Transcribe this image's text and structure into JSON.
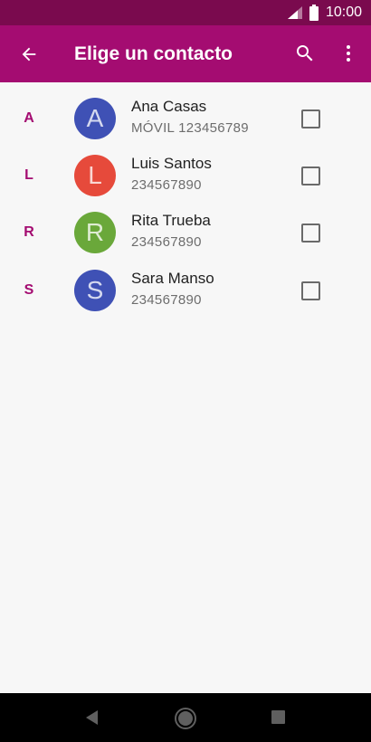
{
  "status_bar": {
    "time": "10:00"
  },
  "app_bar": {
    "title": "Elige un contacto",
    "back_icon": "arrow-back-icon",
    "search_icon": "search-icon",
    "overflow_icon": "more-vert-icon"
  },
  "contacts": [
    {
      "letter": "A",
      "initial": "A",
      "name": "Ana Casas",
      "number": "MÓVIL 123456789",
      "avatar_color": "#3f51b5",
      "checked": false
    },
    {
      "letter": "L",
      "initial": "L",
      "name": "Luis Santos",
      "number": "234567890",
      "avatar_color": "#e64a3b",
      "checked": false
    },
    {
      "letter": "R",
      "initial": "R",
      "name": "Rita Trueba",
      "number": "234567890",
      "avatar_color": "#6aa83a",
      "checked": false
    },
    {
      "letter": "S",
      "initial": "S",
      "name": "Sara Manso",
      "number": "234567890",
      "avatar_color": "#3f51b5",
      "checked": false
    }
  ],
  "colors": {
    "status_bar": "#7a0a4e",
    "app_bar": "#a40c71",
    "accent": "#a40c71",
    "background": "#f7f7f7"
  },
  "nav_bar": {
    "back_icon": "nav-back-icon",
    "home_icon": "nav-home-icon",
    "recents_icon": "nav-recents-icon"
  }
}
